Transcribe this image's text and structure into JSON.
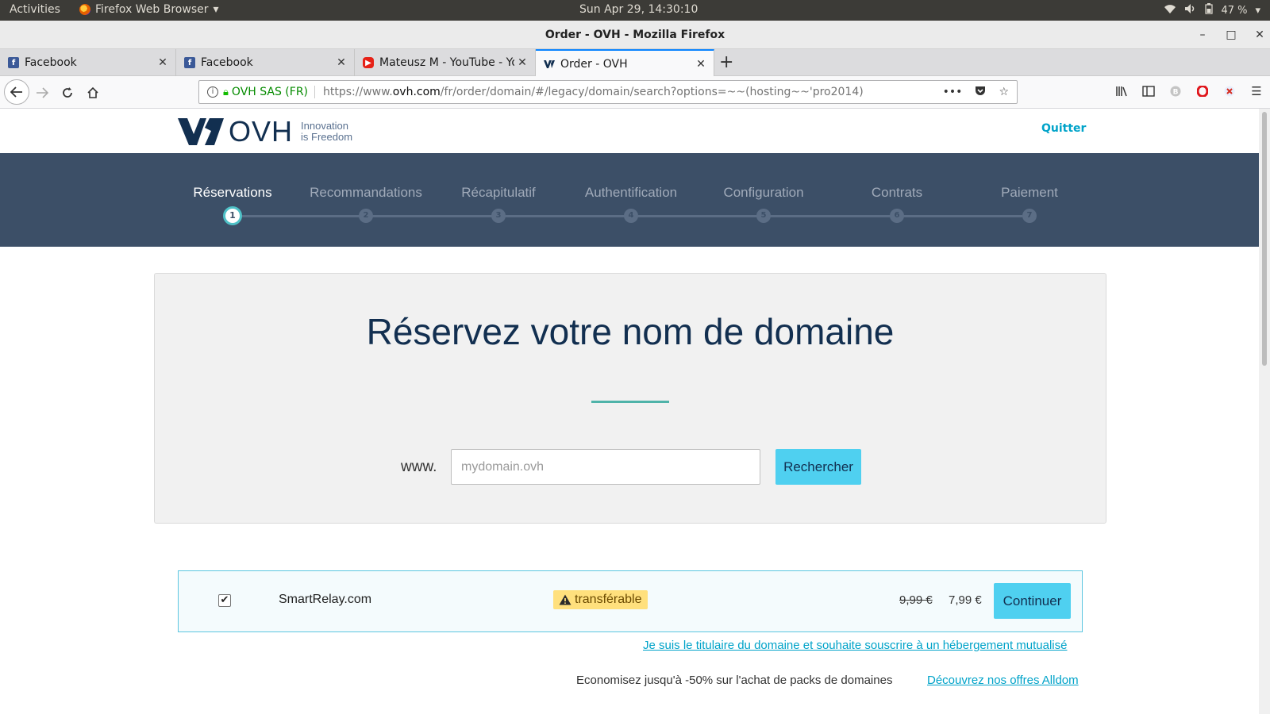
{
  "system_bar": {
    "activities": "Activities",
    "app_name": "Firefox Web Browser",
    "clock": "Sun Apr 29, 14:30:10",
    "battery": "47 %"
  },
  "window": {
    "title": "Order - OVH - Mozilla Firefox"
  },
  "tabs": [
    {
      "title": "Facebook",
      "icon": "facebook-icon",
      "active": false
    },
    {
      "title": "Facebook",
      "icon": "facebook-icon",
      "active": false
    },
    {
      "title": "Mateusz M - YouTube - Yo",
      "icon": "youtube-icon",
      "active": false
    },
    {
      "title": "Order - OVH",
      "icon": "ovh-icon",
      "active": true
    }
  ],
  "urlbar": {
    "org": "OVH SAS (FR)",
    "url_prefix": "https://www.",
    "url_domain": "ovh.com",
    "url_suffix": "/fr/order/domain/#/legacy/domain/search?options=~~(hosting~~'pro2014)"
  },
  "header": {
    "logo_word": "OVH",
    "tagline_1": "Innovation",
    "tagline_2": "is Freedom",
    "quit_label": "Quitter"
  },
  "steps": [
    {
      "label": "Réservations",
      "num": "1",
      "current": true
    },
    {
      "label": "Recommandations",
      "num": "2",
      "current": false
    },
    {
      "label": "Récapitulatif",
      "num": "3",
      "current": false
    },
    {
      "label": "Authentification",
      "num": "4",
      "current": false
    },
    {
      "label": "Configuration",
      "num": "5",
      "current": false
    },
    {
      "label": "Contrats",
      "num": "6",
      "current": false
    },
    {
      "label": "Paiement",
      "num": "7",
      "current": false
    }
  ],
  "search": {
    "heading": "Réservez votre nom de domaine",
    "prefix": "www.",
    "placeholder": "mydomain.ovh",
    "value": "",
    "button": "Rechercher"
  },
  "result": {
    "checked": true,
    "domain": "SmartRelay.com",
    "status": "transférable",
    "old_price": "9,99 €",
    "price": "7,99 €",
    "button": "Continuer"
  },
  "links": {
    "hosting": "Je suis le titulaire du domaine et souhaite souscrire à un hébergement mutualisé",
    "promo": "Economisez jusqu'à -50% sur l'achat de packs de domaines",
    "alldom": "Découvrez nos offres Alldom"
  },
  "colors": {
    "band": "#3c4f67",
    "accent_button": "#4fd0f0",
    "link": "#00a3c9",
    "badge": "#ffe07d"
  }
}
